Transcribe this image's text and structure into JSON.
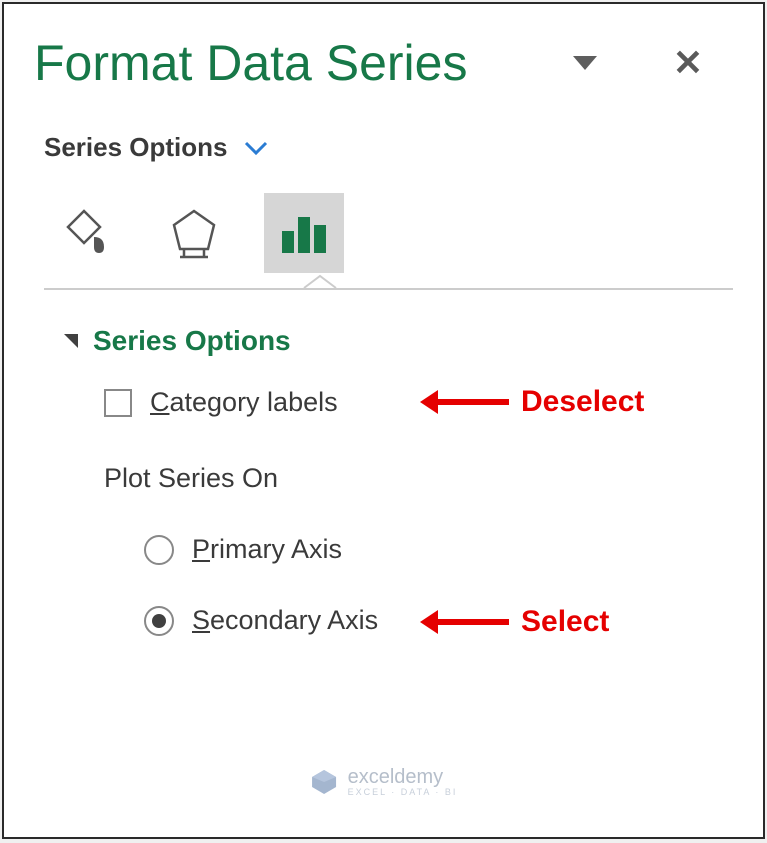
{
  "panel": {
    "title": "Format Data Series"
  },
  "selector": {
    "label": "Series Options"
  },
  "section": {
    "title": "Series Options",
    "category_labels": "Category labels",
    "plot_on": "Plot Series On",
    "primary": "Primary Axis",
    "secondary": "Secondary Axis"
  },
  "annotations": {
    "deselect": "Deselect",
    "select": "Select"
  },
  "watermark": {
    "name": "exceldemy",
    "sub": "EXCEL · DATA · BI"
  }
}
